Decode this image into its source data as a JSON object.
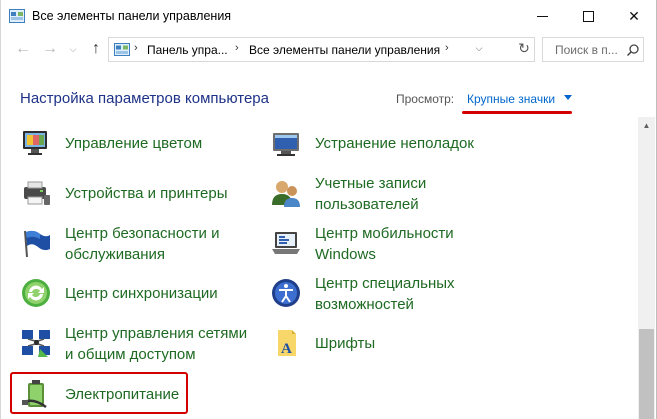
{
  "window": {
    "title": "Все элементы панели управления",
    "min_label": "",
    "max_label": "",
    "close_label": "✕"
  },
  "nav": {
    "back": "←",
    "forward": "→",
    "dropdown": "⌄",
    "up": "↑",
    "breadcrumbs": [
      "Панель упра...",
      "Все элементы панели управления"
    ],
    "separator": "›",
    "refresh": "↻",
    "search_placeholder": "Поиск в п..."
  },
  "header": {
    "title": "Настройка параметров компьютера",
    "view_label": "Просмотр:",
    "view_value": "Крупные значки"
  },
  "items": [
    {
      "label": "Управление цветом",
      "icon": "color-management-icon"
    },
    {
      "label": "Устранение неполадок",
      "icon": "troubleshooting-icon"
    },
    {
      "label": "Устройства и принтеры",
      "icon": "devices-printers-icon"
    },
    {
      "label": "Учетные записи\nпользователей",
      "icon": "user-accounts-icon"
    },
    {
      "label": "Центр безопасности и\nобслуживания",
      "icon": "security-flag-icon"
    },
    {
      "label": "Центр мобильности\nWindows",
      "icon": "mobility-center-icon"
    },
    {
      "label": "Центр синхронизации",
      "icon": "sync-center-icon"
    },
    {
      "label": "Центр специальных\nвозможностей",
      "icon": "accessibility-icon"
    },
    {
      "label": "Центр управления сетями\nи общим доступом",
      "icon": "network-center-icon"
    },
    {
      "label": "Шрифты",
      "icon": "fonts-icon"
    },
    {
      "label": "Электропитание",
      "icon": "power-options-icon"
    }
  ],
  "colors": {
    "link_green": "#1e6a22",
    "title_blue": "#1e3287",
    "highlight_red": "#d40000"
  }
}
